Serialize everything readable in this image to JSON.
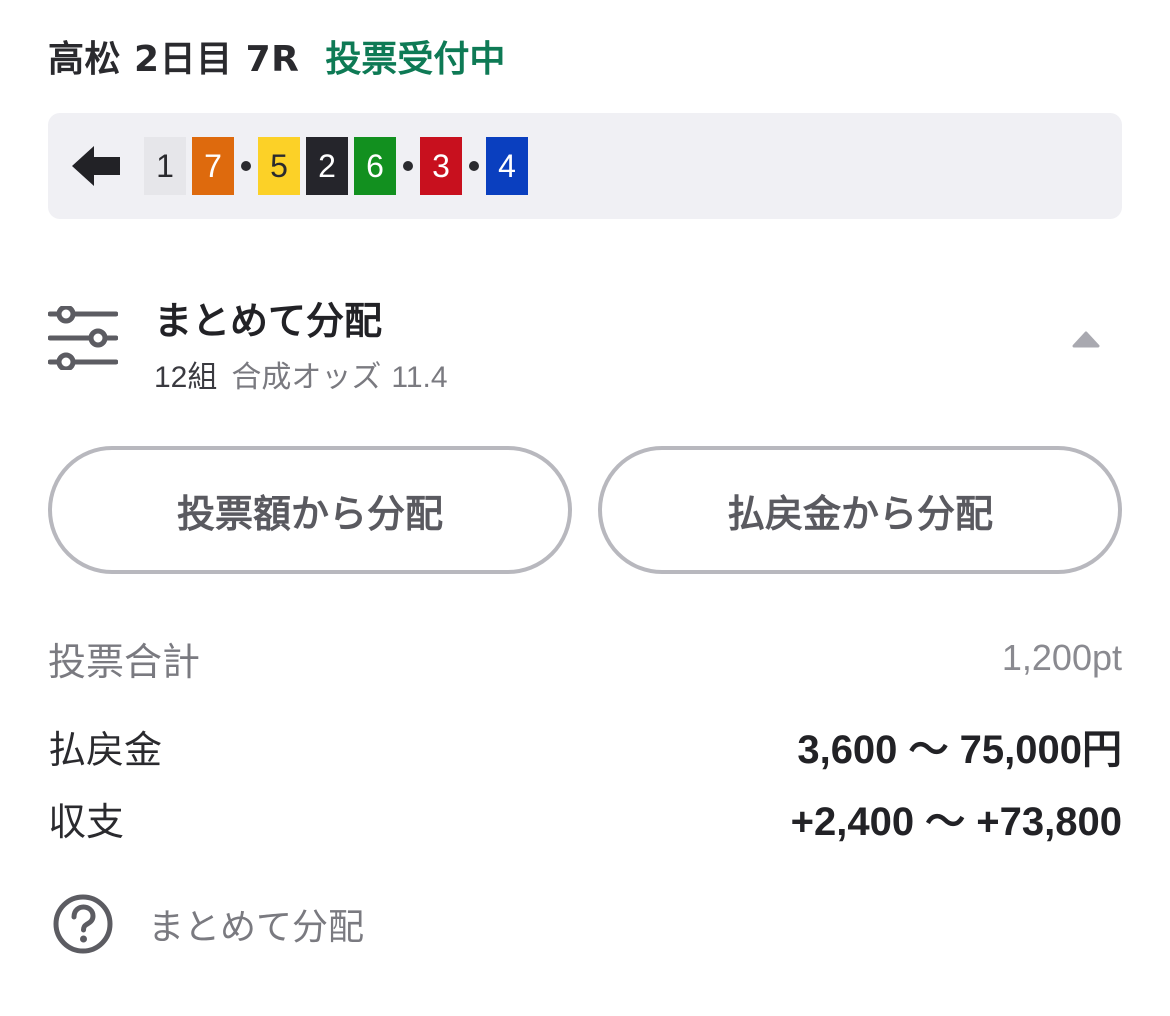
{
  "header": {
    "race_title": "高松 2日目 7R",
    "status": "投票受付中",
    "status_color": "#0e7a55"
  },
  "combination": {
    "back_icon": "arrow-left-icon",
    "first_group": [
      {
        "number": "1",
        "bg": "#e6e6ea",
        "fg": "#2a2a2e"
      },
      {
        "number": "7",
        "bg": "#de6a0d",
        "fg": "#ffffff"
      }
    ],
    "second_group": [
      {
        "number": "5",
        "bg": "#fcd127",
        "fg": "#2a2a2e"
      },
      {
        "number": "2",
        "bg": "#25252b",
        "fg": "#ffffff"
      },
      {
        "number": "6",
        "bg": "#12901f",
        "fg": "#ffffff"
      }
    ],
    "third_group": [
      {
        "number": "3",
        "bg": "#c8101e",
        "fg": "#ffffff"
      }
    ],
    "fourth_group": [
      {
        "number": "4",
        "bg": "#0a3fbf",
        "fg": "#ffffff"
      }
    ]
  },
  "distribution": {
    "icon": "sliders-icon",
    "title": "まとめて分配",
    "count": "12組",
    "odds_label": "合成オッズ",
    "odds_value": "11.4",
    "collapse_icon": "caret-up-icon"
  },
  "buttons": {
    "by_bet": "投票額から分配",
    "by_payout": "払戻金から分配"
  },
  "summary": {
    "total_label": "投票合計",
    "total_value": "1,200pt",
    "payout_label": "払戻金",
    "payout_value": "3,600 ～ 75,000円",
    "balance_label": "収支",
    "balance_value": "+2,400 ～ +73,800"
  },
  "help": {
    "icon": "question-circle-icon",
    "label": "まとめて分配"
  }
}
